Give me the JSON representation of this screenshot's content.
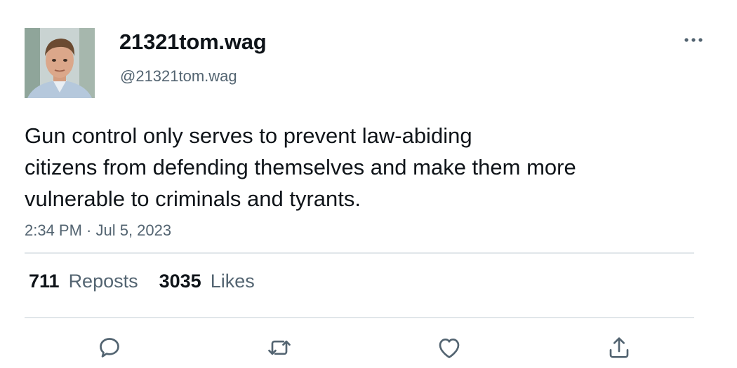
{
  "author": {
    "display_name": "21321tom.wag",
    "handle": "@21321tom.wag",
    "avatar_icon": "profile-photo"
  },
  "tweet": {
    "text_lines": [
      "Gun control only serves to prevent law-abiding",
      "citizens from defending themselves and make them more",
      "vulnerable to criminals and tyrants."
    ],
    "timestamp": "2:34 PM · Jul 5, 2023"
  },
  "stats": {
    "reposts_count": "711",
    "reposts_label": "Reposts",
    "likes_count": "3035",
    "likes_label": "Likes"
  },
  "actions": {
    "more_icon": "more-horizontal-icon",
    "reply_icon": "reply-icon",
    "repost_icon": "repost-icon",
    "like_icon": "heart-icon",
    "share_icon": "share-icon"
  },
  "colors": {
    "text_primary": "#0f1419",
    "text_secondary": "#536471",
    "divider": "#e1e6ea"
  }
}
